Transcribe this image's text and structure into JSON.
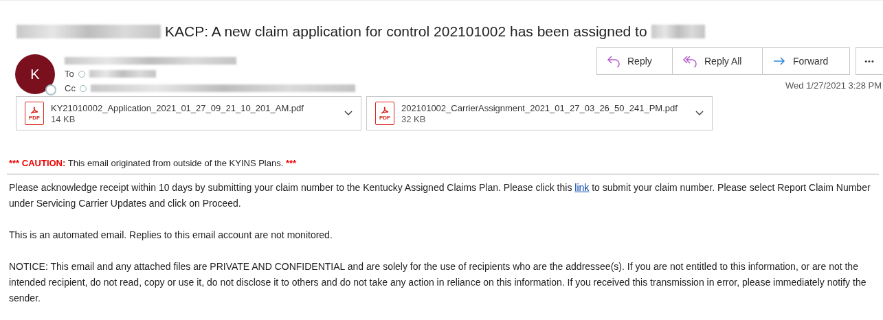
{
  "subject": {
    "text": "KACP: A new claim application  for control 202101002 has been assigned to"
  },
  "sender": {
    "avatar_initial": "K",
    "to_label": "To",
    "cc_label": "Cc"
  },
  "actions": [
    {
      "kind": "reply",
      "label": "Reply"
    },
    {
      "kind": "reply_all",
      "label": "Reply All"
    },
    {
      "kind": "forward",
      "label": "Forward"
    }
  ],
  "more_button": "•••",
  "date": "Wed 1/27/2021 3:28 PM",
  "attachments": [
    {
      "name": "KY21010002_Application_2021_01_27_09_21_10_201_AM.pdf",
      "size": "14 KB",
      "icon_label": "PDF"
    },
    {
      "name": "202101002_CarrierAssignment_2021_01_27_03_26_50_241_PM.pdf",
      "size": "32 KB",
      "icon_label": "PDF"
    }
  ],
  "caution": {
    "prefix": "*** CAUTION:",
    "text": "This email originated from outside of the KYINS Plans.",
    "suffix": "***"
  },
  "body": {
    "p1_before": "Please acknowledge receipt within 10 days by submitting your claim number to the Kentucky Assigned Claims Plan. Please click this",
    "link": "link",
    "p1_after": "to submit your claim number. Please select Report Claim Number under Servicing Carrier Updates and click on Proceed.",
    "p2": "This is an automated email. Replies to this email account are not monitored.",
    "p3": "NOTICE: This email and any attached files are PRIVATE AND CONFIDENTIAL and are solely for the use of recipients who are the addressee(s). If you are not entitled to this information, or are not the intended recipient, do not read, copy or use it, do not disclose it to others and do not take any action in reliance on this information. If you received this transmission in error, please immediately notify the sender."
  }
}
